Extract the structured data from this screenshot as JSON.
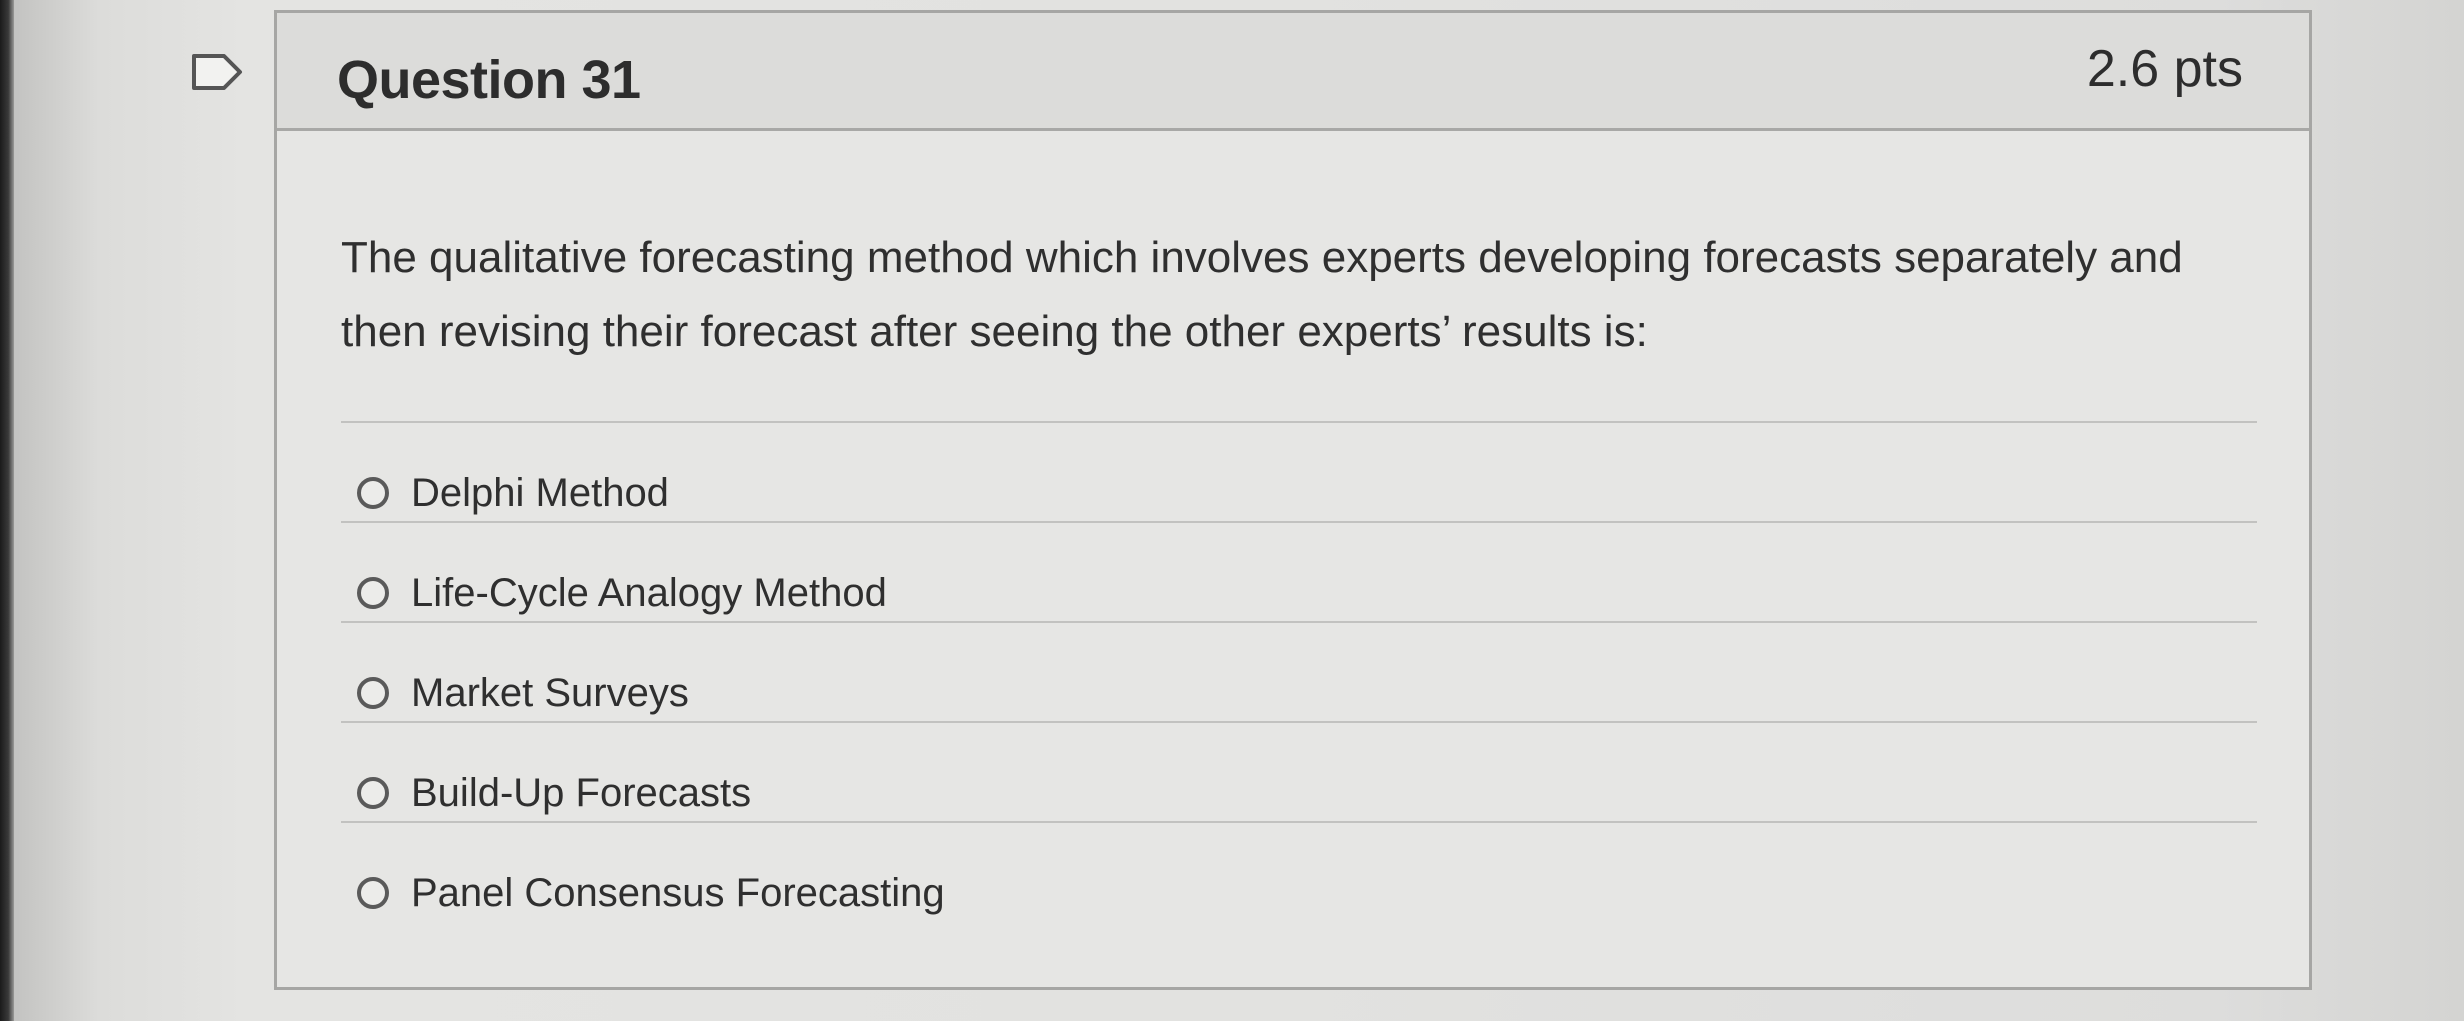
{
  "question": {
    "title": "Question 31",
    "points": "2.6 pts",
    "text": "The qualitative forecasting method which involves experts developing forecasts separately and then revising their forecast after seeing the other experts’ results is:",
    "flag_icon": "flag-outline-icon",
    "answers": [
      {
        "label": "Delphi Method",
        "selected": false
      },
      {
        "label": "Life-Cycle Analogy Method",
        "selected": false
      },
      {
        "label": "Market Surveys",
        "selected": false
      },
      {
        "label": "Build-Up Forecasts",
        "selected": false
      },
      {
        "label": "Panel Consensus Forecasting",
        "selected": false
      }
    ]
  }
}
